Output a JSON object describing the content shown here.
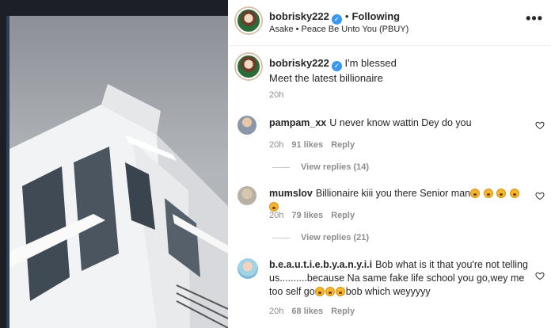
{
  "post": {
    "username": "bobrisky222",
    "following_label": "Following",
    "song": "Asake • Peace Be Unto You (PBUY)",
    "more_icon": "more-horizontal-icon",
    "caption_line1": "I'm blessed",
    "caption_line2": "Meet the latest billionaire",
    "caption_time": "20h"
  },
  "comments": [
    {
      "username": "pampam_xx",
      "text": "U never know wattin Dey do you",
      "time": "20h",
      "likes": "91 likes",
      "reply_label": "Reply",
      "view_replies": "View replies (14)"
    },
    {
      "username": "mumslov",
      "text": "Billionaire kiii you there Senior man",
      "time": "20h",
      "likes": "79 likes",
      "reply_label": "Reply",
      "view_replies": "View replies (21)"
    },
    {
      "username": "b.e.a.u.t.i.e.b.y.a.n.y.i.i",
      "text": "Bob what is it that you're not telling us..........because Na same fake life school you go,wey me too self go",
      "text_tail": "bob which weyyyyy",
      "time": "20h",
      "likes": "68 likes",
      "reply_label": "Reply"
    }
  ],
  "colors": {
    "verified": "#3897f0",
    "muted": "#8e8e8e",
    "text": "#262626"
  }
}
